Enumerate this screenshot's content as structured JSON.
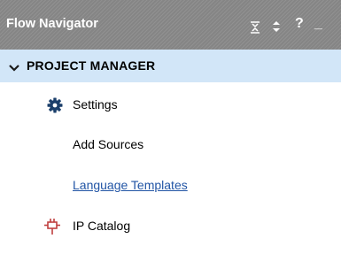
{
  "header": {
    "title": "Flow Navigator",
    "icons": [
      "collapse-all-icon",
      "expand-all-icon",
      "help-icon",
      "minimize-icon"
    ],
    "help_label": "?",
    "min_label": "_"
  },
  "section": {
    "label": "PROJECT MANAGER",
    "expanded": true,
    "icon": "chevron-down-icon"
  },
  "items": [
    {
      "label": "Settings",
      "icon": "gear-icon"
    },
    {
      "label": "Add Sources"
    },
    {
      "label": "Language Templates"
    },
    {
      "label": "IP Catalog",
      "icon": "ip-chip-icon"
    }
  ],
  "colors": {
    "header_bg": "#858585",
    "section_bg": "#d2e6f8",
    "link": "#2255a5",
    "icon_dark": "#1b3f6b",
    "ip_icon": "#c04040"
  }
}
